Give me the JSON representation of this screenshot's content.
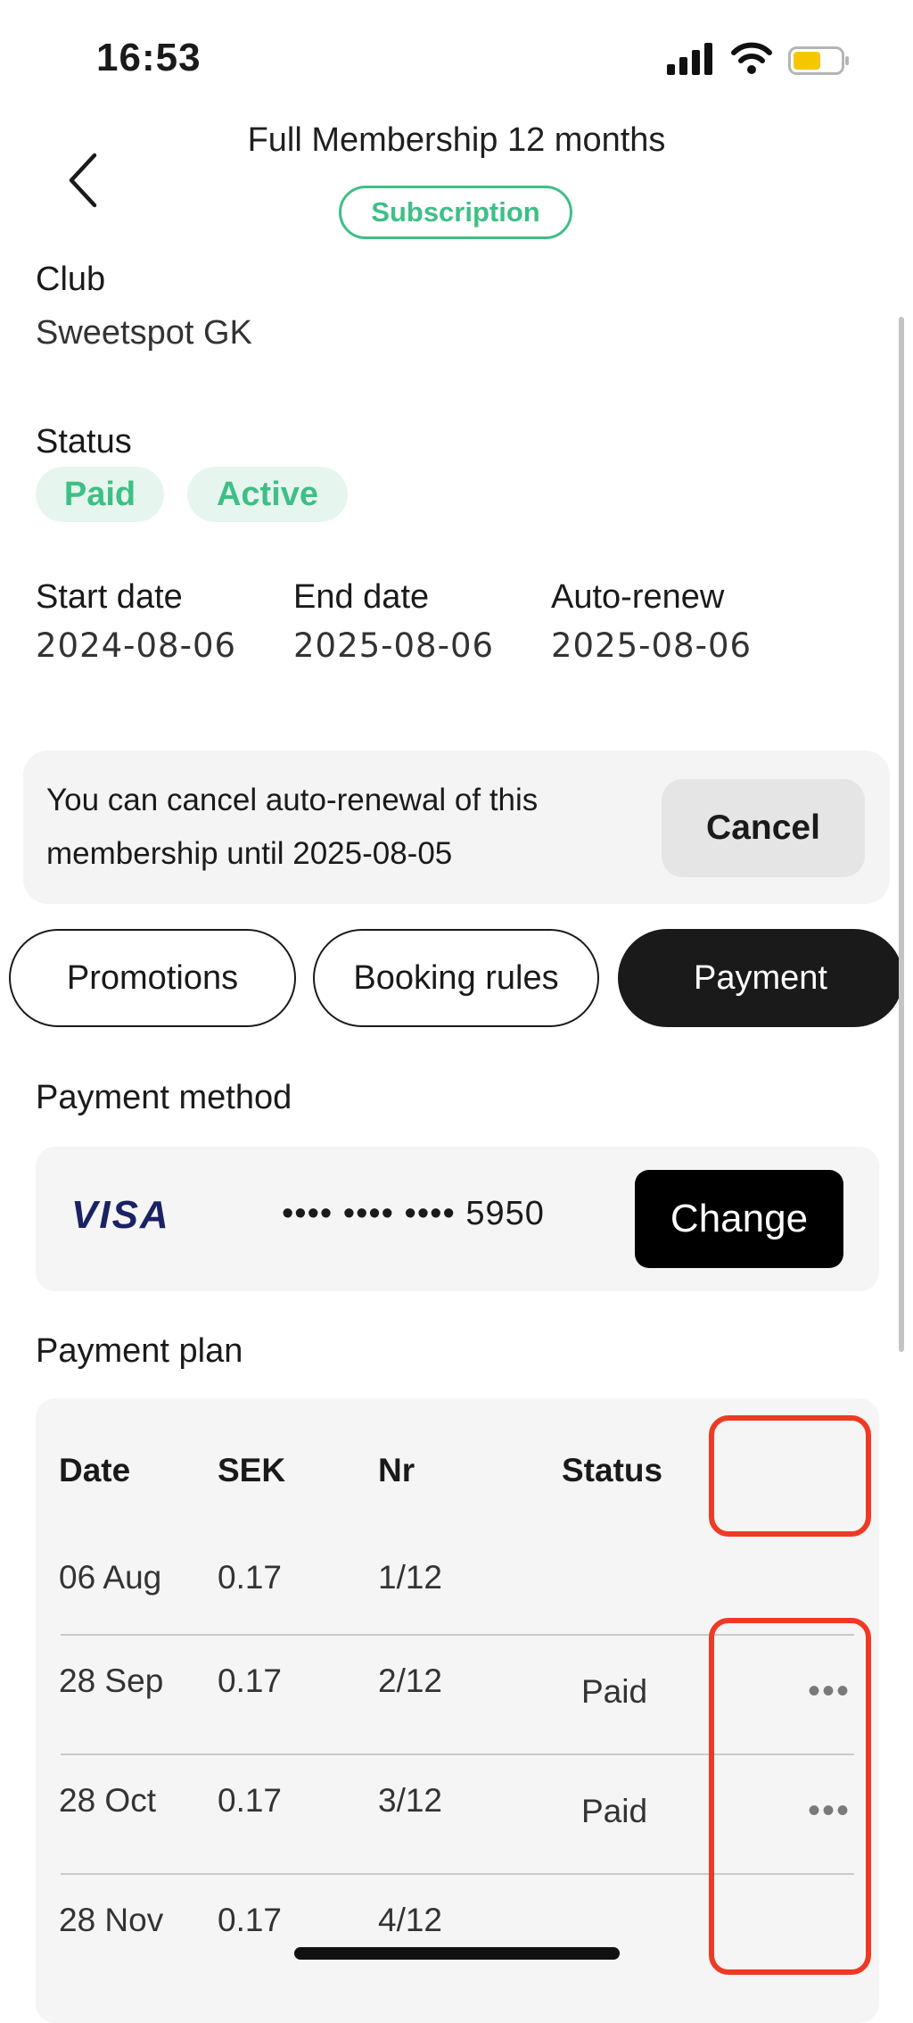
{
  "status_bar": {
    "time": "16:53"
  },
  "header": {
    "title": "Full Membership 12 months",
    "subscription_badge": "Subscription"
  },
  "club": {
    "label": "Club",
    "value": "Sweetspot GK"
  },
  "status": {
    "label": "Status",
    "badges": [
      "Paid",
      "Active"
    ]
  },
  "dates": {
    "start_label": "Start date",
    "start_value": "2024-08-06",
    "end_label": "End date",
    "end_value": "2025-08-06",
    "renew_label": "Auto-renew",
    "renew_value": "2025-08-06"
  },
  "notice": {
    "line1": "You can cancel auto-renewal of this",
    "line2": "membership until 2025-08-05",
    "cancel_label": "Cancel"
  },
  "tabs": [
    {
      "label": "Promotions",
      "active": false
    },
    {
      "label": "Booking rules",
      "active": false
    },
    {
      "label": "Payment",
      "active": true
    }
  ],
  "payment_method": {
    "label": "Payment method",
    "brand": "VISA",
    "masked_number": "•••• •••• •••• 5950",
    "change_label": "Change"
  },
  "payment_plan": {
    "label": "Payment plan",
    "columns": [
      "Date",
      "SEK",
      "Nr",
      "Status"
    ],
    "rows": [
      {
        "date": "06 Aug",
        "sek": "0.17",
        "nr": "1/12",
        "status": ""
      },
      {
        "date": "28 Sep",
        "sek": "0.17",
        "nr": "2/12",
        "status": "Paid"
      },
      {
        "date": "28 Oct",
        "sek": "0.17",
        "nr": "3/12",
        "status": "Paid"
      },
      {
        "date": "28 Nov",
        "sek": "0.17",
        "nr": "4/12",
        "status": ""
      }
    ],
    "more_icon": "•••"
  },
  "colors": {
    "accent_green": "#3ebf86",
    "badge_bg": "#e6f6ee",
    "highlight_red": "#ee3a24",
    "dark": "#1a1a1a"
  }
}
